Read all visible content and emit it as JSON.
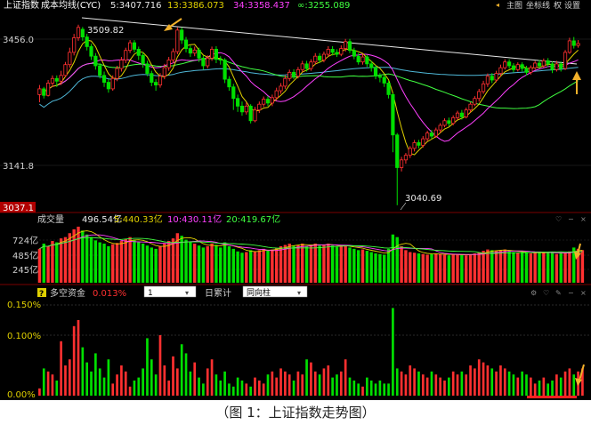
{
  "caption": "（图 1：上证指数走势图）",
  "colors": {
    "background": "#000000",
    "up": "#ff3030",
    "down": "#00e000",
    "ma5": "#ffffff",
    "ma13": "#e0d000",
    "ma34": "#ff40ff",
    "ma_inf": "#40ff40",
    "cost_line": "#4fb8d8",
    "trend_line": "#e8e8e8",
    "axis_text": "#d0d0d0",
    "price_highlight": "#ff3030",
    "annotation_arrow": "#f2b02a"
  },
  "top_bar": {
    "index_name": "上证指数",
    "indicator_name": "成本均线(CYC)",
    "ma5": "5:3407.716",
    "ma13": "13:3386.073",
    "ma34": "34:3358.437",
    "ma_inf": "∞:3255.089",
    "buttons": [
      "主图",
      "坐标线",
      "权",
      "设置"
    ]
  },
  "price_panel": {
    "y_axis": [
      "3456.0",
      "3141.8",
      "3037.1"
    ],
    "annotations": {
      "high": "3509.82",
      "low": "3040.69"
    },
    "ylim": [
      3030,
      3530
    ]
  },
  "volume_panel": {
    "label": "成交量",
    "total": "496.54亿",
    "ma5": "5:440.33亿",
    "ma10": "10:430.11亿",
    "ma20": "20:419.67亿",
    "y_axis": [
      "724亿",
      "485亿",
      "245亿"
    ]
  },
  "fund_panel": {
    "label": "多空资金",
    "value": "0.013%",
    "select1_value": "1",
    "tab_label": "日累计",
    "select2_value": "同向柱",
    "y_axis": [
      "0.150%",
      "0.100%",
      "0.00%"
    ]
  },
  "chart_data": [
    {
      "type": "candlestick",
      "title": "上证指数 成本均线(CYC)",
      "series": [
        {
          "name": "5",
          "last": 3407.716
        },
        {
          "name": "13",
          "last": 3386.073
        },
        {
          "name": "34",
          "last": 3358.437
        },
        {
          "name": "∞",
          "last": 3255.089
        }
      ],
      "y_ticks": [
        3456.0,
        3141.8,
        3037.1
      ],
      "annotations": [
        {
          "label": "3509.82",
          "value": 3509.82
        },
        {
          "label": "3040.69",
          "value": 3040.69
        }
      ],
      "ylim": [
        3030,
        3530
      ],
      "candles": [
        [
          3330,
          3345,
          3310,
          3355
        ],
        [
          3345,
          3328,
          3320,
          3350
        ],
        [
          3328,
          3360,
          3325,
          3368
        ],
        [
          3360,
          3372,
          3350,
          3380
        ],
        [
          3372,
          3365,
          3350,
          3380
        ],
        [
          3365,
          3380,
          3355,
          3392
        ],
        [
          3380,
          3408,
          3375,
          3415
        ],
        [
          3408,
          3440,
          3400,
          3452
        ],
        [
          3440,
          3478,
          3432,
          3488
        ],
        [
          3478,
          3505,
          3470,
          3512
        ],
        [
          3500,
          3480,
          3470,
          3506
        ],
        [
          3480,
          3455,
          3445,
          3488
        ],
        [
          3455,
          3430,
          3420,
          3462
        ],
        [
          3430,
          3405,
          3395,
          3438
        ],
        [
          3405,
          3380,
          3372,
          3412
        ],
        [
          3380,
          3362,
          3350,
          3390
        ],
        [
          3362,
          3345,
          3335,
          3370
        ],
        [
          3345,
          3372,
          3340,
          3380
        ],
        [
          3372,
          3398,
          3365,
          3405
        ],
        [
          3398,
          3420,
          3390,
          3428
        ],
        [
          3420,
          3445,
          3412,
          3452
        ],
        [
          3445,
          3465,
          3438,
          3472
        ],
        [
          3465,
          3448,
          3440,
          3472
        ],
        [
          3448,
          3432,
          3420,
          3455
        ],
        [
          3432,
          3410,
          3400,
          3440
        ],
        [
          3410,
          3385,
          3378,
          3418
        ],
        [
          3385,
          3362,
          3352,
          3392
        ],
        [
          3362,
          3355,
          3340,
          3370
        ],
        [
          3355,
          3378,
          3348,
          3386
        ],
        [
          3378,
          3400,
          3370,
          3410
        ],
        [
          3400,
          3420,
          3392,
          3428
        ],
        [
          3420,
          3442,
          3412,
          3450
        ],
        [
          3442,
          3498,
          3435,
          3505
        ],
        [
          3498,
          3472,
          3462,
          3505
        ],
        [
          3472,
          3450,
          3440,
          3480
        ],
        [
          3450,
          3438,
          3428,
          3458
        ],
        [
          3438,
          3446,
          3430,
          3455
        ],
        [
          3446,
          3425,
          3415,
          3452
        ],
        [
          3425,
          3405,
          3395,
          3432
        ],
        [
          3405,
          3425,
          3398,
          3432
        ],
        [
          3425,
          3448,
          3418,
          3455
        ],
        [
          3448,
          3422,
          3412,
          3456
        ],
        [
          3422,
          3420,
          3408,
          3430
        ],
        [
          3420,
          3370,
          3360,
          3425
        ],
        [
          3370,
          3350,
          3340,
          3378
        ],
        [
          3350,
          3320,
          3290,
          3358
        ],
        [
          3320,
          3300,
          3285,
          3330
        ],
        [
          3300,
          3285,
          3275,
          3312
        ],
        [
          3285,
          3300,
          3278,
          3310
        ],
        [
          3300,
          3262,
          3255,
          3305
        ],
        [
          3262,
          3290,
          3258,
          3298
        ],
        [
          3290,
          3305,
          3282,
          3312
        ],
        [
          3305,
          3318,
          3298,
          3325
        ],
        [
          3318,
          3308,
          3300,
          3326
        ],
        [
          3308,
          3322,
          3300,
          3330
        ],
        [
          3322,
          3340,
          3315,
          3348
        ],
        [
          3340,
          3352,
          3332,
          3360
        ],
        [
          3352,
          3372,
          3345,
          3380
        ],
        [
          3372,
          3388,
          3365,
          3395
        ],
        [
          3388,
          3378,
          3370,
          3396
        ],
        [
          3378,
          3395,
          3372,
          3402
        ],
        [
          3395,
          3410,
          3388,
          3418
        ],
        [
          3410,
          3398,
          3390,
          3418
        ],
        [
          3398,
          3415,
          3392,
          3422
        ],
        [
          3415,
          3430,
          3408,
          3438
        ],
        [
          3430,
          3420,
          3412,
          3438
        ],
        [
          3420,
          3435,
          3414,
          3442
        ],
        [
          3435,
          3448,
          3428,
          3456
        ],
        [
          3448,
          3440,
          3432,
          3456
        ],
        [
          3440,
          3435,
          3428,
          3448
        ],
        [
          3435,
          3450,
          3430,
          3458
        ],
        [
          3450,
          3468,
          3442,
          3475
        ],
        [
          3468,
          3445,
          3438,
          3475
        ],
        [
          3445,
          3430,
          3422,
          3452
        ],
        [
          3430,
          3415,
          3408,
          3438
        ],
        [
          3415,
          3428,
          3408,
          3436
        ],
        [
          3428,
          3410,
          3402,
          3434
        ],
        [
          3410,
          3400,
          3390,
          3418
        ],
        [
          3400,
          3378,
          3370,
          3406
        ],
        [
          3378,
          3375,
          3362,
          3386
        ],
        [
          3375,
          3360,
          3350,
          3382
        ],
        [
          3360,
          3330,
          3320,
          3366
        ],
        [
          3330,
          3225,
          3180,
          3334
        ],
        [
          3225,
          3140,
          3042,
          3230
        ],
        [
          3140,
          3160,
          3130,
          3168
        ],
        [
          3160,
          3172,
          3150,
          3178
        ],
        [
          3172,
          3190,
          3165,
          3196
        ],
        [
          3190,
          3205,
          3182,
          3212
        ],
        [
          3205,
          3198,
          3190,
          3212
        ],
        [
          3198,
          3215,
          3192,
          3222
        ],
        [
          3215,
          3230,
          3208,
          3236
        ],
        [
          3230,
          3222,
          3215,
          3238
        ],
        [
          3222,
          3238,
          3218,
          3244
        ],
        [
          3238,
          3250,
          3230,
          3256
        ],
        [
          3250,
          3262,
          3245,
          3268
        ],
        [
          3262,
          3255,
          3248,
          3270
        ],
        [
          3255,
          3270,
          3250,
          3276
        ],
        [
          3270,
          3282,
          3264,
          3288
        ],
        [
          3282,
          3272,
          3265,
          3290
        ],
        [
          3272,
          3290,
          3268,
          3296
        ],
        [
          3290,
          3305,
          3284,
          3310
        ],
        [
          3305,
          3320,
          3300,
          3326
        ],
        [
          3320,
          3338,
          3312,
          3345
        ],
        [
          3338,
          3358,
          3332,
          3366
        ],
        [
          3358,
          3378,
          3350,
          3385
        ],
        [
          3378,
          3368,
          3360,
          3386
        ],
        [
          3368,
          3385,
          3362,
          3392
        ],
        [
          3385,
          3400,
          3378,
          3408
        ],
        [
          3400,
          3415,
          3395,
          3422
        ],
        [
          3415,
          3405,
          3398,
          3422
        ],
        [
          3405,
          3395,
          3388,
          3412
        ],
        [
          3395,
          3408,
          3390,
          3414
        ],
        [
          3408,
          3398,
          3390,
          3414
        ],
        [
          3398,
          3388,
          3380,
          3405
        ],
        [
          3388,
          3400,
          3382,
          3406
        ],
        [
          3400,
          3412,
          3395,
          3418
        ],
        [
          3412,
          3405,
          3398,
          3420
        ],
        [
          3405,
          3418,
          3400,
          3424
        ],
        [
          3418,
          3410,
          3402,
          3425
        ],
        [
          3410,
          3395,
          3386,
          3416
        ],
        [
          3395,
          3410,
          3390,
          3418
        ],
        [
          3410,
          3398,
          3390,
          3416
        ],
        [
          3398,
          3440,
          3394,
          3446
        ],
        [
          3440,
          3470,
          3436,
          3478
        ],
        [
          3470,
          3458,
          3450,
          3480
        ],
        [
          3458,
          3463,
          3452,
          3472
        ]
      ]
    },
    {
      "type": "bar",
      "title": "成交量",
      "series": [
        {
          "name": "成交量",
          "last": "496.54亿"
        },
        {
          "name": "5",
          "last": "440.33亿"
        },
        {
          "name": "10",
          "last": "430.11亿"
        },
        {
          "name": "20",
          "last": "419.67亿"
        }
      ],
      "y_ticks": [
        "724亿",
        "485亿",
        "245亿"
      ],
      "ylim": [
        0,
        900
      ],
      "values": [
        520,
        600,
        560,
        640,
        620,
        680,
        700,
        760,
        820,
        860,
        800,
        740,
        700,
        650,
        620,
        600,
        560,
        590,
        610,
        640,
        670,
        700,
        660,
        620,
        600,
        570,
        540,
        520,
        560,
        600,
        640,
        680,
        760,
        720,
        660,
        620,
        600,
        570,
        540,
        560,
        600,
        580,
        540,
        620,
        560,
        520,
        480,
        460,
        470,
        500,
        480,
        500,
        520,
        500,
        510,
        530,
        560,
        580,
        600,
        570,
        580,
        600,
        560,
        580,
        600,
        570,
        580,
        600,
        570,
        550,
        560,
        580,
        540,
        520,
        500,
        510,
        490,
        470,
        450,
        440,
        430,
        520,
        740,
        700,
        560,
        500,
        470,
        460,
        450,
        440,
        430,
        440,
        450,
        440,
        430,
        420,
        430,
        440,
        430,
        420,
        430,
        450,
        470,
        490,
        510,
        500,
        490,
        500,
        510,
        480,
        470,
        460,
        470,
        460,
        450,
        460,
        470,
        460,
        470,
        460,
        440,
        460,
        450,
        480,
        540,
        520,
        500
      ]
    },
    {
      "type": "bar",
      "title": "多空资金",
      "series": [
        {
          "name": "多空资金",
          "last": "0.013%"
        }
      ],
      "y_ticks": [
        "0.150%",
        "0.100%",
        "0.00%"
      ],
      "ylim": [
        0,
        0.15
      ],
      "values": [
        0.012,
        0.045,
        0.04,
        0.035,
        0.025,
        0.09,
        0.05,
        0.06,
        0.115,
        0.125,
        0.08,
        0.055,
        0.04,
        0.07,
        0.045,
        0.03,
        0.06,
        0.02,
        0.035,
        0.05,
        0.04,
        0.015,
        0.025,
        0.03,
        0.045,
        0.095,
        0.06,
        0.035,
        0.1,
        0.05,
        0.025,
        0.065,
        0.045,
        0.085,
        0.07,
        0.04,
        0.055,
        0.03,
        0.02,
        0.045,
        0.06,
        0.035,
        0.025,
        0.04,
        0.02,
        0.015,
        0.03,
        0.025,
        0.02,
        0.015,
        0.03,
        0.025,
        0.02,
        0.035,
        0.04,
        0.03,
        0.045,
        0.04,
        0.035,
        0.025,
        0.04,
        0.035,
        0.06,
        0.055,
        0.04,
        0.035,
        0.045,
        0.05,
        0.03,
        0.035,
        0.04,
        0.06,
        0.03,
        0.025,
        0.02,
        0.015,
        0.03,
        0.025,
        0.02,
        0.025,
        0.02,
        0.02,
        0.145,
        0.045,
        0.04,
        0.035,
        0.05,
        0.045,
        0.04,
        0.035,
        0.03,
        0.04,
        0.035,
        0.03,
        0.025,
        0.03,
        0.04,
        0.035,
        0.04,
        0.035,
        0.05,
        0.045,
        0.06,
        0.055,
        0.05,
        0.045,
        0.04,
        0.05,
        0.045,
        0.04,
        0.035,
        0.03,
        0.04,
        0.035,
        0.03,
        0.02,
        0.025,
        0.03,
        0.02,
        0.025,
        0.035,
        0.03,
        0.04,
        0.045,
        0.035,
        0.04,
        0.045
      ]
    }
  ]
}
